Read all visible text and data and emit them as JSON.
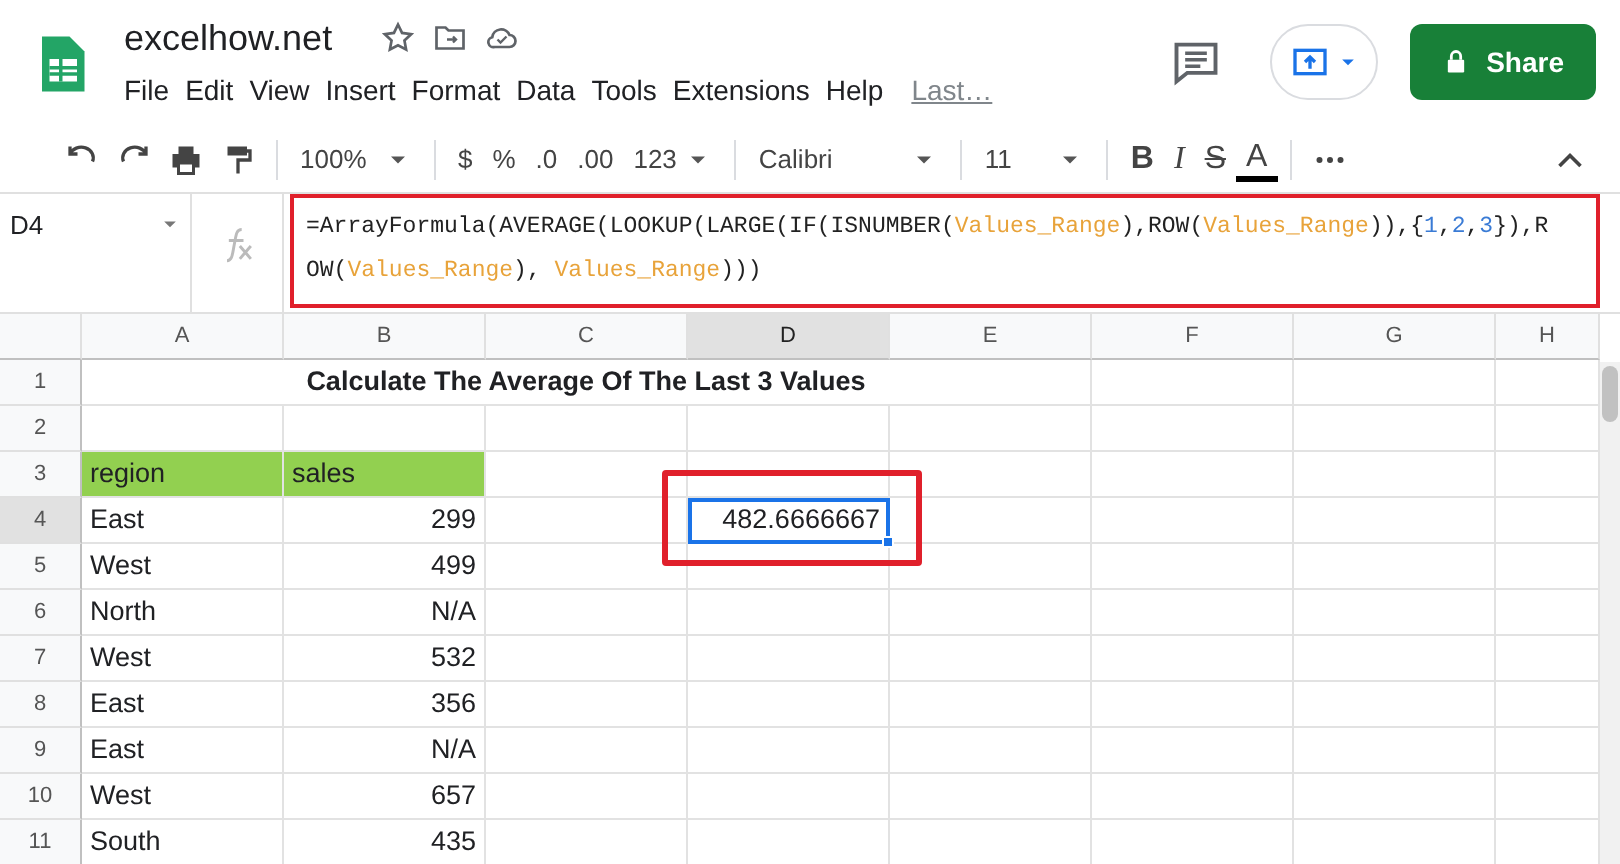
{
  "document": {
    "title": "excelhow.net"
  },
  "menu": [
    "File",
    "Edit",
    "View",
    "Insert",
    "Format",
    "Data",
    "Tools",
    "Extensions",
    "Help"
  ],
  "last_edit": "Last…",
  "share_button": "Share",
  "toolbar": {
    "zoom": "100%",
    "currency": "$",
    "percent": "%",
    "decrease_decimals": ".0",
    "increase_decimals": ".00",
    "more_formats": "123",
    "font": "Calibri",
    "font_size": "11",
    "bold": "B",
    "italic": "I",
    "strikethrough": "S",
    "text_color": "A"
  },
  "name_box": "D4",
  "formula": [
    {
      "kind": "plain",
      "text": "=ArrayFormula(AVERAGE(LOOKUP(LARGE(IF(ISNUMBER("
    },
    {
      "kind": "range",
      "text": "Values_Range"
    },
    {
      "kind": "plain",
      "text": "),ROW("
    },
    {
      "kind": "range",
      "text": "Values_Range"
    },
    {
      "kind": "plain",
      "text": ")),{"
    },
    {
      "kind": "number",
      "text": "1"
    },
    {
      "kind": "plain",
      "text": ","
    },
    {
      "kind": "number",
      "text": "2"
    },
    {
      "kind": "plain",
      "text": ","
    },
    {
      "kind": "number",
      "text": "3"
    },
    {
      "kind": "plain",
      "text": "}),ROW("
    },
    {
      "kind": "range",
      "text": "Values_Range"
    },
    {
      "kind": "plain",
      "text": "), "
    },
    {
      "kind": "range",
      "text": "Values_Range"
    },
    {
      "kind": "plain",
      "text": ")))"
    }
  ],
  "columns": [
    {
      "label": "A",
      "selected": false
    },
    {
      "label": "B",
      "selected": false
    },
    {
      "label": "C",
      "selected": false
    },
    {
      "label": "D",
      "selected": true
    },
    {
      "label": "E",
      "selected": false
    },
    {
      "label": "F",
      "selected": false
    },
    {
      "label": "G",
      "selected": false
    },
    {
      "label": "H",
      "selected": false
    }
  ],
  "rows": [
    {
      "label": "1",
      "selected": false,
      "cells": [
        {
          "kind": "title",
          "text": "Calculate The Average Of The Last 3 Values",
          "selected": false
        }
      ]
    },
    {
      "label": "2",
      "selected": false,
      "cells": []
    },
    {
      "label": "3",
      "selected": false,
      "cells": [
        {
          "kind": "header",
          "text": "region",
          "selected": false
        },
        {
          "kind": "header",
          "text": "sales",
          "selected": false
        }
      ]
    },
    {
      "label": "4",
      "selected": true,
      "cells": [
        {
          "kind": "text",
          "text": "East",
          "selected": false
        },
        {
          "kind": "number",
          "text": "299",
          "selected": false
        },
        {
          "kind": "empty",
          "text": "",
          "selected": false
        },
        {
          "kind": "number",
          "text": "482.6666667",
          "selected": true
        }
      ]
    },
    {
      "label": "5",
      "selected": false,
      "cells": [
        {
          "kind": "text",
          "text": "West",
          "selected": false
        },
        {
          "kind": "number",
          "text": "499",
          "selected": false
        }
      ]
    },
    {
      "label": "6",
      "selected": false,
      "cells": [
        {
          "kind": "text",
          "text": "North",
          "selected": false
        },
        {
          "kind": "number",
          "text": "N/A",
          "selected": false
        }
      ]
    },
    {
      "label": "7",
      "selected": false,
      "cells": [
        {
          "kind": "text",
          "text": "West",
          "selected": false
        },
        {
          "kind": "number",
          "text": "532",
          "selected": false
        }
      ]
    },
    {
      "label": "8",
      "selected": false,
      "cells": [
        {
          "kind": "text",
          "text": "East",
          "selected": false
        },
        {
          "kind": "number",
          "text": "356",
          "selected": false
        }
      ]
    },
    {
      "label": "9",
      "selected": false,
      "cells": [
        {
          "kind": "text",
          "text": "East",
          "selected": false
        },
        {
          "kind": "number",
          "text": "N/A",
          "selected": false
        }
      ]
    },
    {
      "label": "10",
      "selected": false,
      "cells": [
        {
          "kind": "text",
          "text": "West",
          "selected": false
        },
        {
          "kind": "number",
          "text": "657",
          "selected": false
        }
      ]
    },
    {
      "label": "11",
      "selected": false,
      "cells": [
        {
          "kind": "text",
          "text": "South",
          "selected": false
        },
        {
          "kind": "number",
          "text": "435",
          "selected": false
        }
      ]
    }
  ]
}
